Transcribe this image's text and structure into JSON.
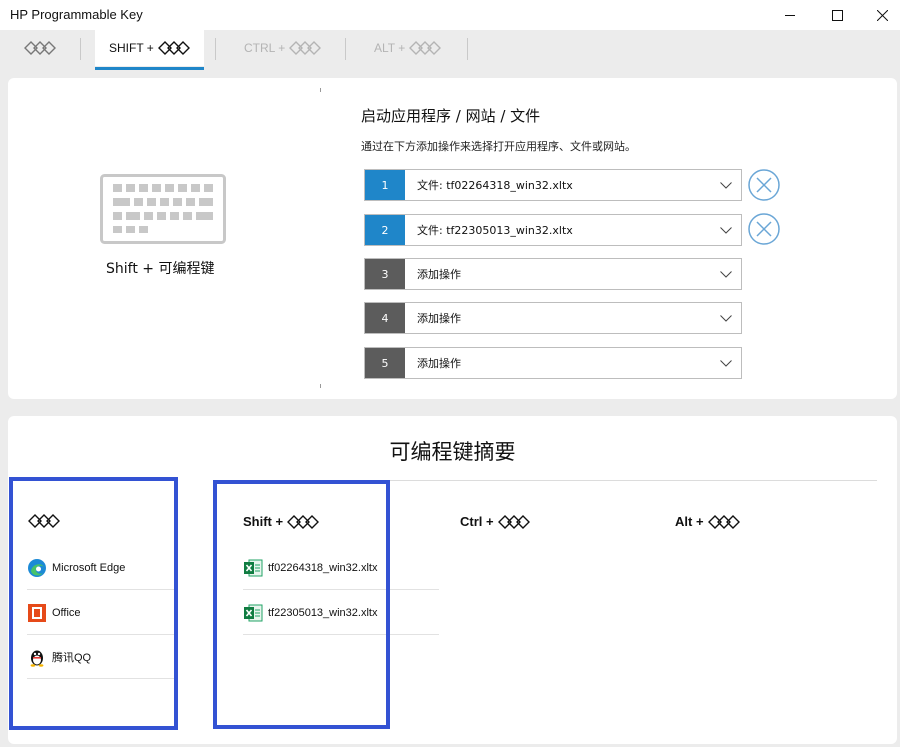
{
  "window": {
    "title": "HP Programmable Key",
    "icons": [
      "minimize-icon",
      "maximize-icon",
      "close-icon"
    ]
  },
  "tabs": [
    {
      "label": "",
      "icon": "prog-key-icon",
      "active": false
    },
    {
      "label": "SHIFT +",
      "icon": "prog-key-icon",
      "active": true
    },
    {
      "label": "CTRL +",
      "icon": "prog-key-icon",
      "active": false
    },
    {
      "label": "ALT +",
      "icon": "prog-key-icon",
      "active": false
    }
  ],
  "config": {
    "key_label": "Shift + 可编程键",
    "title": "启动应用程序 / 网站 / 文件",
    "description": "通过在下方添加操作来选择打开应用程序、文件或网站。",
    "actions": [
      {
        "num": "1",
        "value": "文件: tf02264318_win32.xltx",
        "assigned": true
      },
      {
        "num": "2",
        "value": "文件: tf22305013_win32.xltx",
        "assigned": true
      },
      {
        "num": "3",
        "value": "添加操作",
        "assigned": false
      },
      {
        "num": "4",
        "value": "添加操作",
        "assigned": false
      },
      {
        "num": "5",
        "value": "添加操作",
        "assigned": false
      }
    ]
  },
  "summary": {
    "title": "可编程键摘要",
    "columns": [
      {
        "head": "",
        "items": [
          "Microsoft Edge",
          "Office",
          "腾讯QQ"
        ]
      },
      {
        "head": "Shift +",
        "items": [
          "tf02264318_win32.xltx",
          "tf22305013_win32.xltx"
        ]
      },
      {
        "head": "Ctrl +",
        "items": []
      },
      {
        "head": "Alt +",
        "items": []
      }
    ]
  },
  "colors": {
    "accent": "#1f86c9",
    "unassigned": "#5c5c5c",
    "highlight": "#3352d3",
    "background": "#ececec"
  }
}
